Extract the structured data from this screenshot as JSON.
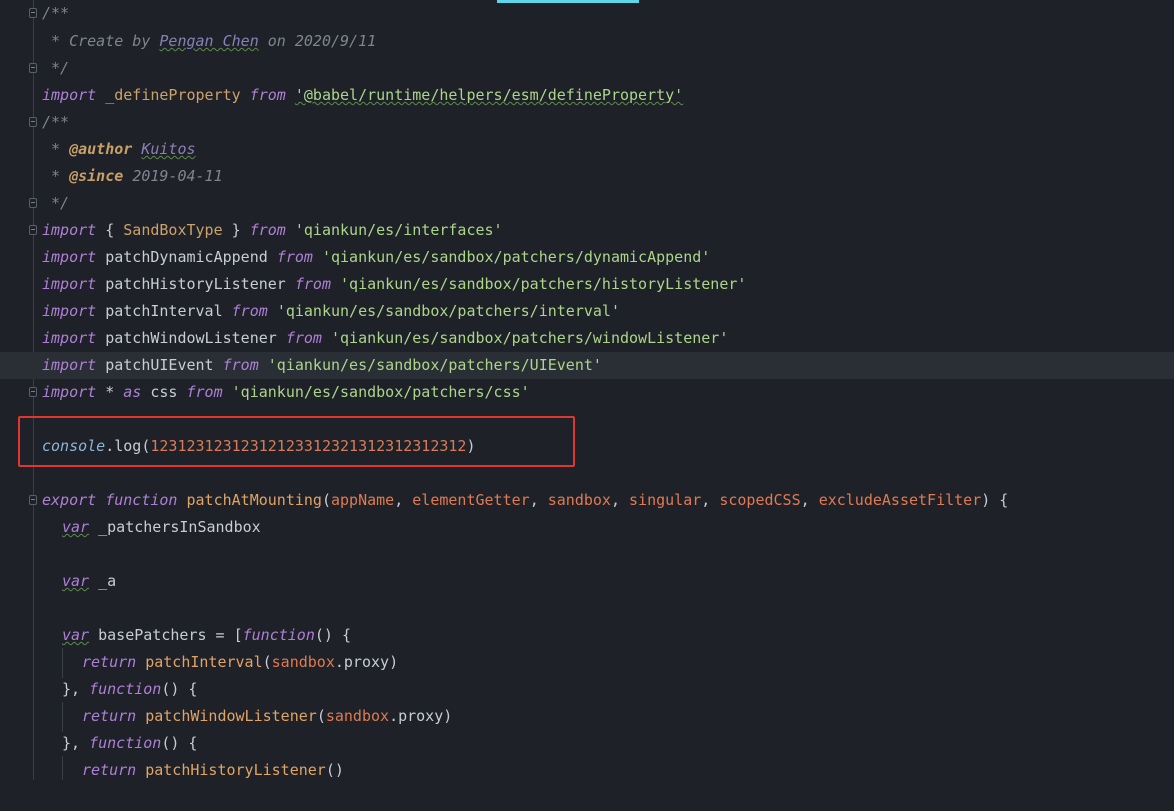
{
  "editor": {
    "lines": {
      "l1": {
        "comment": "/**"
      },
      "l2": {
        "prefix": " * Create by ",
        "author": "Pengan Chen",
        "suffix": " on 2020/9/11"
      },
      "l3": {
        "comment": " */"
      },
      "l4": {
        "kw": "import",
        "name": "_defineProperty",
        "from": "from",
        "path": "'@babel/runtime/helpers/esm/defineProperty'"
      },
      "l5": {
        "comment": "/**"
      },
      "l6": {
        "star": " * ",
        "tag": "@author",
        "value": "Kuitos"
      },
      "l7": {
        "star": " * ",
        "tag": "@since",
        "value": "2019-04-11"
      },
      "l8": {
        "comment": " */"
      },
      "l9": {
        "kw": "import",
        "open": " { ",
        "name": "SandBoxType",
        "close": " } ",
        "from": "from",
        "path": "'qiankun/es/interfaces'"
      },
      "l10": {
        "kw": "import",
        "name": "patchDynamicAppend",
        "from": "from",
        "path": "'qiankun/es/sandbox/patchers/dynamicAppend'"
      },
      "l11": {
        "kw": "import",
        "name": "patchHistoryListener",
        "from": "from",
        "path": "'qiankun/es/sandbox/patchers/historyListener'"
      },
      "l12": {
        "kw": "import",
        "name": "patchInterval",
        "from": "from",
        "path": "'qiankun/es/sandbox/patchers/interval'"
      },
      "l13": {
        "kw": "import",
        "name": "patchWindowListener",
        "from": "from",
        "path": "'qiankun/es/sandbox/patchers/windowListener'"
      },
      "l14": {
        "kw": "import",
        "name": "patchUIEvent",
        "from": "from",
        "path": "'qiankun/es/sandbox/patchers/UIEvent'"
      },
      "l15": {
        "kw": "import",
        "star": " * ",
        "as": "as",
        "name": " css ",
        "from": "from",
        "path": "'qiankun/es/sandbox/patchers/css'"
      },
      "l17": {
        "obj": "console",
        "method": ".log",
        "open": "(",
        "arg": "12312312312312123312321312312312312",
        "close": ")"
      },
      "l19": {
        "kw1": "export",
        "kw2": "function",
        "name": "patchAtMounting",
        "open": "(",
        "p1": "appName",
        "p2": "elementGetter",
        "p3": "sandbox",
        "p4": "singular",
        "p5": "scopedCSS",
        "p6": "excludeAssetFilter",
        "comma": ", ",
        "close": ") {"
      },
      "l20": {
        "kw": "var",
        "name": " _patchersInSandbox"
      },
      "l22": {
        "kw": "var",
        "name": " _a"
      },
      "l24": {
        "kw": "var",
        "name": " basePatchers = [",
        "fn": "function",
        "tail": "() {"
      },
      "l25": {
        "kw": "return",
        "call": "patchInterval",
        "open": "(",
        "obj": "sandbox",
        "prop": ".proxy",
        "close": ")"
      },
      "l26": {
        "head": "}, ",
        "fn": "function",
        "tail": "() {"
      },
      "l27": {
        "kw": "return",
        "call": "patchWindowListener",
        "open": "(",
        "obj": "sandbox",
        "prop": ".proxy",
        "close": ")"
      },
      "l28": {
        "head": "}, ",
        "fn": "function",
        "tail": "() {"
      },
      "l29": {
        "kw": "return",
        "call": "patchHistoryListener",
        "tail": "()"
      }
    },
    "colors": {
      "background": "#1e2127",
      "current_line": "#2a2e35",
      "highlight_box": "#e0362f",
      "active_tab": "#5fd6e8"
    }
  }
}
